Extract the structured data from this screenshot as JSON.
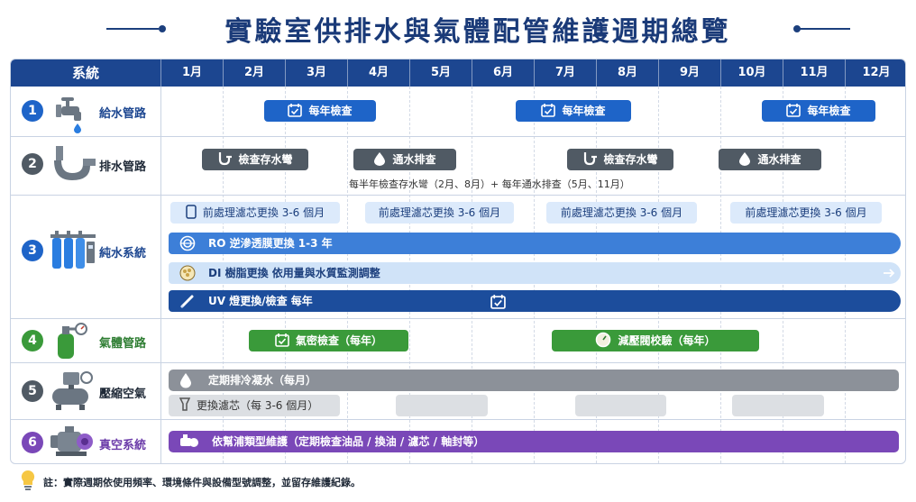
{
  "title": "實驗室供排水與氣體配管維護週期總覽",
  "header": {
    "system": "系統",
    "months": [
      "1月",
      "2月",
      "3月",
      "4月",
      "5月",
      "6月",
      "7月",
      "8月",
      "9月",
      "10月",
      "11月",
      "12月"
    ]
  },
  "colors": {
    "navy": "#1c4690",
    "blue": "#1e64c8",
    "gray": "#505a64",
    "green": "#3a9a3a",
    "purple": "#7a48b8"
  },
  "systems": [
    {
      "num": "1",
      "name": "給水管路",
      "icon": "faucet-icon",
      "color": "#1e64c8",
      "items": [
        {
          "label": "每年檢查",
          "icon": "calendar-check-icon",
          "month": 3
        },
        {
          "label": "每年檢查",
          "icon": "calendar-check-icon",
          "month": 7
        },
        {
          "label": "每年檢查",
          "icon": "calendar-check-icon",
          "month": 11
        }
      ]
    },
    {
      "num": "2",
      "name": "排水管路",
      "icon": "drain-pipe-icon",
      "color": "#505a64",
      "items": [
        {
          "label": "檢查存水彎",
          "icon": "trap-icon",
          "month": 2
        },
        {
          "label": "通水排查",
          "icon": "water-drop-icon",
          "month": 5
        },
        {
          "label": "檢查存水彎",
          "icon": "trap-icon",
          "month": 8
        },
        {
          "label": "通水排查",
          "icon": "water-drop-icon",
          "month": 11
        }
      ],
      "note": "每半年檢查存水彎（2月、8月）+ 每年通水排查（5月、11月）"
    },
    {
      "num": "3",
      "name": "純水系統",
      "icon": "water-purifier-icon",
      "color": "#1e64c8",
      "filters": [
        "前處理濾芯更換 3-6 個月",
        "前處理濾芯更換 3-6 個月",
        "前處理濾芯更換 3-6 個月",
        "前處理濾芯更換 3-6 個月"
      ],
      "bars": [
        {
          "label": "RO 逆滲透膜更換 1-3 年",
          "icon": "ro-membrane-icon"
        },
        {
          "label": "DI 樹脂更換 依用量與水質監測調整",
          "icon": "resin-icon"
        },
        {
          "label": "UV 燈更換/檢查 每年",
          "icon": "uv-lamp-icon"
        }
      ]
    },
    {
      "num": "4",
      "name": "氣體管路",
      "icon": "gas-cylinder-icon",
      "color": "#3a9a3a",
      "items": [
        {
          "label": "氣密檢查（每年）",
          "icon": "calendar-check-icon",
          "month": 3
        },
        {
          "label": "減壓閥校驗（每年）",
          "icon": "gauge-icon",
          "month": 8
        }
      ]
    },
    {
      "num": "5",
      "name": "壓縮空氣",
      "icon": "compressor-icon",
      "color": "#505a64",
      "bars": [
        {
          "label": "定期排冷凝水（每月）",
          "icon": "water-drop-icon"
        },
        {
          "label": "更換濾芯（每 3-6 個月）",
          "icon": "filter-icon"
        }
      ]
    },
    {
      "num": "6",
      "name": "真空系統",
      "icon": "vacuum-pump-icon",
      "color": "#7a48b8",
      "bars": [
        {
          "label": "依幫浦類型維護（定期檢查油品 / 換油 / 濾芯 / 軸封等）",
          "icon": "pump-icon"
        }
      ]
    }
  ],
  "footnote": "註：實際週期依使用頻率、環境條件與設備型號調整，並留存維護紀錄。"
}
